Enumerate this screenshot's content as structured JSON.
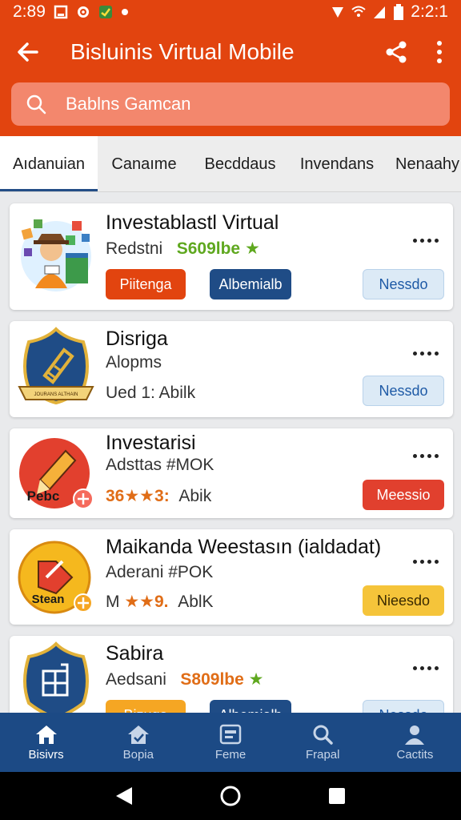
{
  "status_bar": {
    "time": "2:89",
    "clock_right": "2:2:1"
  },
  "app_bar": {
    "title": "Bisluinis Virtual Mobile"
  },
  "search": {
    "placeholder": "Bablns Gamcan"
  },
  "tabs": [
    {
      "label": "Aıdanuian",
      "active": true
    },
    {
      "label": "Canaıme",
      "active": false
    },
    {
      "label": "Becddaus",
      "active": false
    },
    {
      "label": "Invendans",
      "active": false
    },
    {
      "label": "Nenaahy",
      "active": false
    }
  ],
  "cards": [
    {
      "title": "Investablastl Virtual",
      "line1_prefix": "Redstni",
      "price": "S609lbe",
      "star": "★",
      "buttons": [
        "Piitenga",
        "Albemialb",
        "Nessdo"
      ]
    },
    {
      "title": "Disriga",
      "line1": "Alopms",
      "line2": "Ued 1: Abilk",
      "badge_text": "JOURANS ALTHAIN",
      "buttons": [
        "Nessdo"
      ]
    },
    {
      "title": "Investarisi",
      "line1": "Adsttas #MOK",
      "rating_num": "36",
      "rating_stars": "★★",
      "rating_tail": "3:",
      "line2_tail": "Abik",
      "icon_label": "Pebc",
      "buttons": [
        "Meessio"
      ]
    },
    {
      "title": "Maikanda Weestasın (ialdadat)",
      "line1": "Aderani #POK",
      "rating_prefix": "M",
      "rating_stars": "★★",
      "rating_tail": "9.",
      "line2_tail": "AblK",
      "icon_label": "Stean",
      "buttons": [
        "Nieesdo"
      ]
    },
    {
      "title": "Sabira",
      "line1_prefix": "Aedsani",
      "price": "S809lbe",
      "star": "★",
      "buttons": [
        "Bizuga",
        "Albemialb",
        "Nessdo"
      ]
    }
  ],
  "bottom_nav": [
    {
      "label": "Bisivrs",
      "icon": "home-icon",
      "active": true
    },
    {
      "label": "Bopia",
      "icon": "house-check-icon",
      "active": false
    },
    {
      "label": "Feme",
      "icon": "card-icon",
      "active": false
    },
    {
      "label": "Frapal",
      "icon": "search-icon",
      "active": false
    },
    {
      "label": "Cactits",
      "icon": "person-icon",
      "active": false
    }
  ],
  "colors": {
    "primary": "#e2440f",
    "navy": "#1c4a85",
    "search_bg": "#f3876d",
    "price_green": "#5fa81f",
    "price_orange": "#e06d17"
  }
}
